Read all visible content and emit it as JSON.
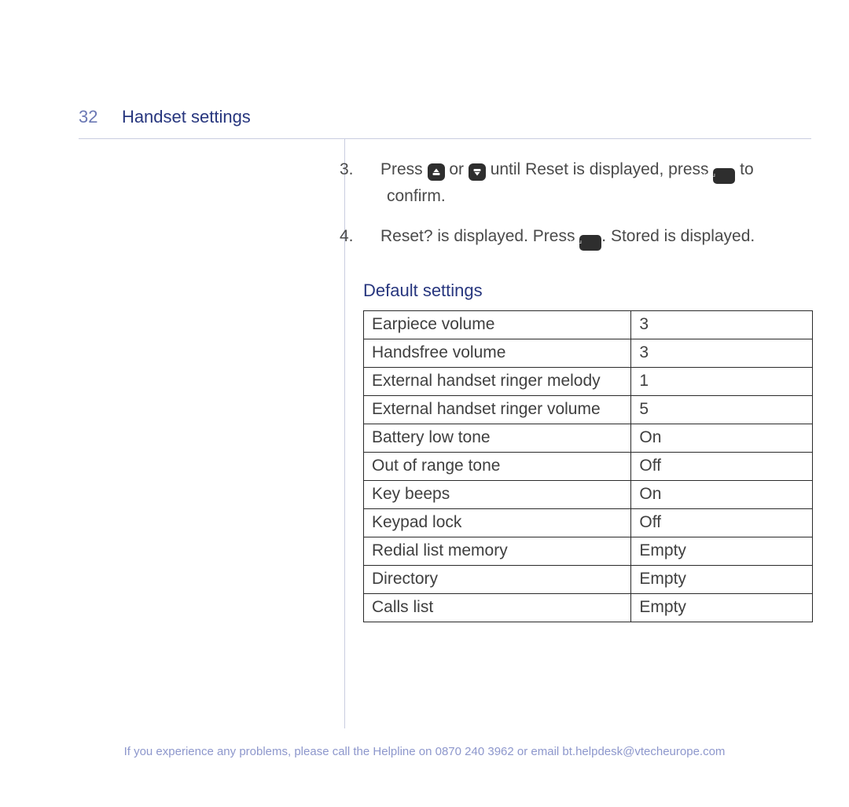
{
  "header": {
    "page_number": "32",
    "title": "Handset settings"
  },
  "steps": {
    "s3": {
      "num": "3.",
      "t1": "Press ",
      "t2": " or ",
      "t3": " until ",
      "reset_word": "Reset",
      "t4": " is displayed, press ",
      "t5": " to confirm."
    },
    "s4": {
      "num": "4.",
      "reset_q": "Reset?",
      "t1": " is displayed. Press ",
      "t2": ". ",
      "stored_word": "Stored",
      "t3": " is displayed."
    }
  },
  "icons": {
    "up_label": "up",
    "down_label": "down",
    "menu_label": "Menu"
  },
  "section_heading": "Default settings",
  "defaults": [
    {
      "name": "Earpiece volume",
      "value": "3"
    },
    {
      "name": "Handsfree volume",
      "value": "3"
    },
    {
      "name": "External handset ringer melody",
      "value": "1"
    },
    {
      "name": "External handset ringer volume",
      "value": "5"
    },
    {
      "name": "Battery low tone",
      "value": "On"
    },
    {
      "name": "Out of range tone",
      "value": "Off"
    },
    {
      "name": "Key beeps",
      "value": "On"
    },
    {
      "name": "Keypad lock",
      "value": "Off"
    },
    {
      "name": "Redial list memory",
      "value": "Empty"
    },
    {
      "name": "Directory",
      "value": "Empty"
    },
    {
      "name": "Calls list",
      "value": "Empty"
    }
  ],
  "footer": "If you experience any problems, please call the Helpline on 0870 240 3962 or email bt.helpdesk@vtecheurope.com"
}
